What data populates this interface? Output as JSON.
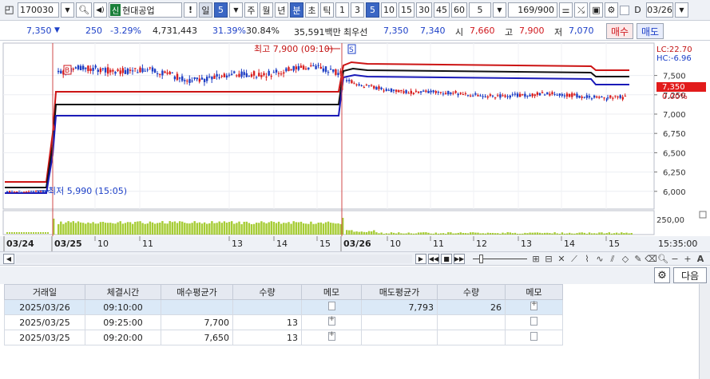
{
  "toolbar": {
    "stock_code": "170030",
    "stock_badge": "신",
    "stock_name": "현대공업",
    "alert": "!",
    "period_day": "일",
    "period_value": "5",
    "period_week": "주",
    "period_month": "월",
    "period_year": "년",
    "period_minute": "분",
    "period_second": "초",
    "period_tick": "틱",
    "intervals": [
      "1",
      "3",
      "5",
      "10",
      "15",
      "30",
      "45",
      "60"
    ],
    "interval_selected": "5",
    "custom_interval": "5",
    "count": "169/900",
    "date_checkbox_label": "D",
    "date_value": "03/26"
  },
  "quote": {
    "price": "7,350",
    "direction": "▼",
    "change": "250",
    "change_pct": "-3.29%",
    "volume": "4,731,443",
    "ratio1": "31.39%",
    "ratio2": "30.84%",
    "amount": "35,591백만",
    "best_ask_label": "최우선",
    "best_ask": "7,350",
    "best_bid": "7,340",
    "open_label": "시",
    "open": "7,660",
    "high_label": "고",
    "high": "7,900",
    "low_label": "저",
    "low": "7,070",
    "buy_label": "매수",
    "sell_label": "매도"
  },
  "chart": {
    "high_annotation": "최고 7,900 (09:10)",
    "low_annotation": "최저 5,990 (15:05)",
    "lc_label": "LC:22.70",
    "hc_label": "HC:-6.96",
    "current_price_tag": "7,350",
    "current_pct_tag": "0.00%",
    "price_ticks": [
      "7,500",
      "7,250",
      "7,000",
      "6,750",
      "6,500",
      "6,250",
      "6,000"
    ],
    "volume_tick": "250,00",
    "date_labels": [
      "03/24",
      "03/25",
      "03/26"
    ],
    "hour_labels": [
      "10",
      "11",
      "13",
      "14",
      "15",
      "10",
      "11",
      "12",
      "13",
      "14",
      "15"
    ],
    "time_label": "15:35:00",
    "marker_buy": "B",
    "marker_sell": "S",
    "colors": {
      "candle_up": "#d81e1e",
      "candle_down": "#1f3fc4",
      "line_high": "#cc1414",
      "line_mid": "#111111",
      "line_low": "#1a1ab8",
      "volume_bar": "#a6cc35",
      "divider": "#d04848"
    }
  },
  "trades": {
    "headers": [
      "거래일",
      "체결시간",
      "매수평균가",
      "수량",
      "메모",
      "매도평균가",
      "수량",
      "메모"
    ],
    "rows": [
      {
        "date": "2025/03/26",
        "time": "09:10:00",
        "buy_avg": "",
        "buy_qty": "",
        "sell_avg": "7,793",
        "sell_qty": "26"
      },
      {
        "date": "2025/03/25",
        "time": "09:25:00",
        "buy_avg": "7,700",
        "buy_qty": "13",
        "sell_avg": "",
        "sell_qty": ""
      },
      {
        "date": "2025/03/25",
        "time": "09:20:00",
        "buy_avg": "7,650",
        "buy_qty": "13",
        "sell_avg": "",
        "sell_qty": ""
      }
    ],
    "next_label": "다음"
  }
}
